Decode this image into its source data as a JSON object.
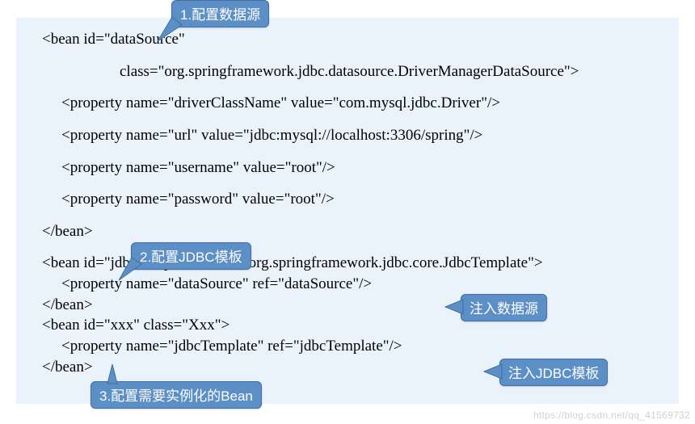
{
  "code": {
    "l1": "<bean id=\"dataSource\"",
    "l2": "class=\"org.springframework.jdbc.datasource.DriverManagerDataSource\">",
    "l3": "<property name=\"driverClassName\" value=\"com.mysql.jdbc.Driver\"/>",
    "l4": "<property name=\"url\" value=\"jdbc:mysql://localhost:3306/spring\"/>",
    "l5": "<property name=\"username\" value=\"root\"/>",
    "l6": "<property name=\"password\" value=\"root\"/>",
    "l7": "</bean>",
    "l8": "<bean id=\"jdbcTemplate\" class=\"org.springframework.jdbc.core.JdbcTemplate\">",
    "l9": "<property name=\"dataSource\" ref=\"dataSource\"/>",
    "l10": "</bean>",
    "l11": "<bean id=\"xxx\" class=\"Xxx\">",
    "l12": "<property name=\"jdbcTemplate\" ref=\"jdbcTemplate\"/>",
    "l13": "</bean>"
  },
  "callouts": {
    "c1": "1.配置数据源",
    "c2": "2.配置JDBC模板",
    "c3": "注入数据源",
    "c4": "注入JDBC模板",
    "c5": "3.配置需要实例化的Bean"
  },
  "watermark": "https://blog.csdn.net/qq_41569732"
}
